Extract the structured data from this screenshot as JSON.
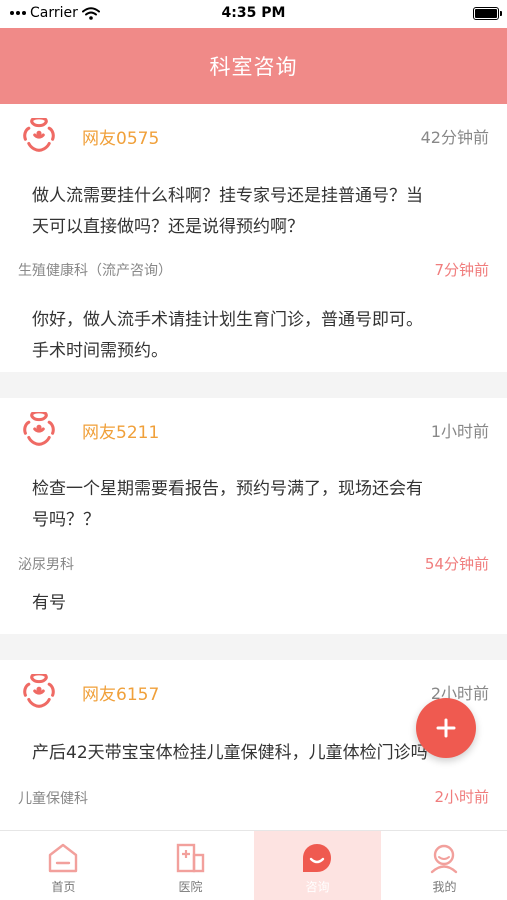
{
  "status_bar": {
    "carrier": "Carrier",
    "time": "4:35 PM"
  },
  "header": {
    "title": "科室咨询"
  },
  "posts": [
    {
      "user": "网友0575",
      "ago": "42分钟前",
      "question_line1": "做人流需要挂什么科啊？挂专家号还是挂普通号？当",
      "question_line2": "天可以直接做吗？还是说得预约啊？",
      "department": "生殖健康科（流产咨询）",
      "reply_time": "7分钟前",
      "answer_line1": "你好，做人流手术请挂计划生育门诊，普通号即可。",
      "answer_line2": "手术时间需预约。"
    },
    {
      "user": "网友5211",
      "ago": "1小时前",
      "question_line1": "检查一个星期需要看报告，预约号满了，现场还会有",
      "question_line2": "号吗？？",
      "department": "泌尿男科",
      "reply_time": "54分钟前",
      "answer_line1": "有号"
    },
    {
      "user": "网友6157",
      "ago": "2小时前",
      "question_line1": "产后42天带宝宝体检挂儿童保健科，儿童体检门诊吗",
      "department": "儿童保健科",
      "reply_time": "2小时前"
    }
  ],
  "fab": {
    "icon": "plus-icon"
  },
  "tabs": [
    {
      "label": "首页",
      "icon": "home-icon",
      "active": false
    },
    {
      "label": "医院",
      "icon": "hospital-icon",
      "active": false
    },
    {
      "label": "咨询",
      "icon": "chat-icon",
      "active": true
    },
    {
      "label": "我的",
      "icon": "profile-icon",
      "active": false
    }
  ],
  "colors": {
    "header": "#f08a88",
    "username": "#f0a03a",
    "reply_time": "#f07d7d",
    "fab": "#ef5a50",
    "active_tab_bg": "#fde3e1"
  }
}
